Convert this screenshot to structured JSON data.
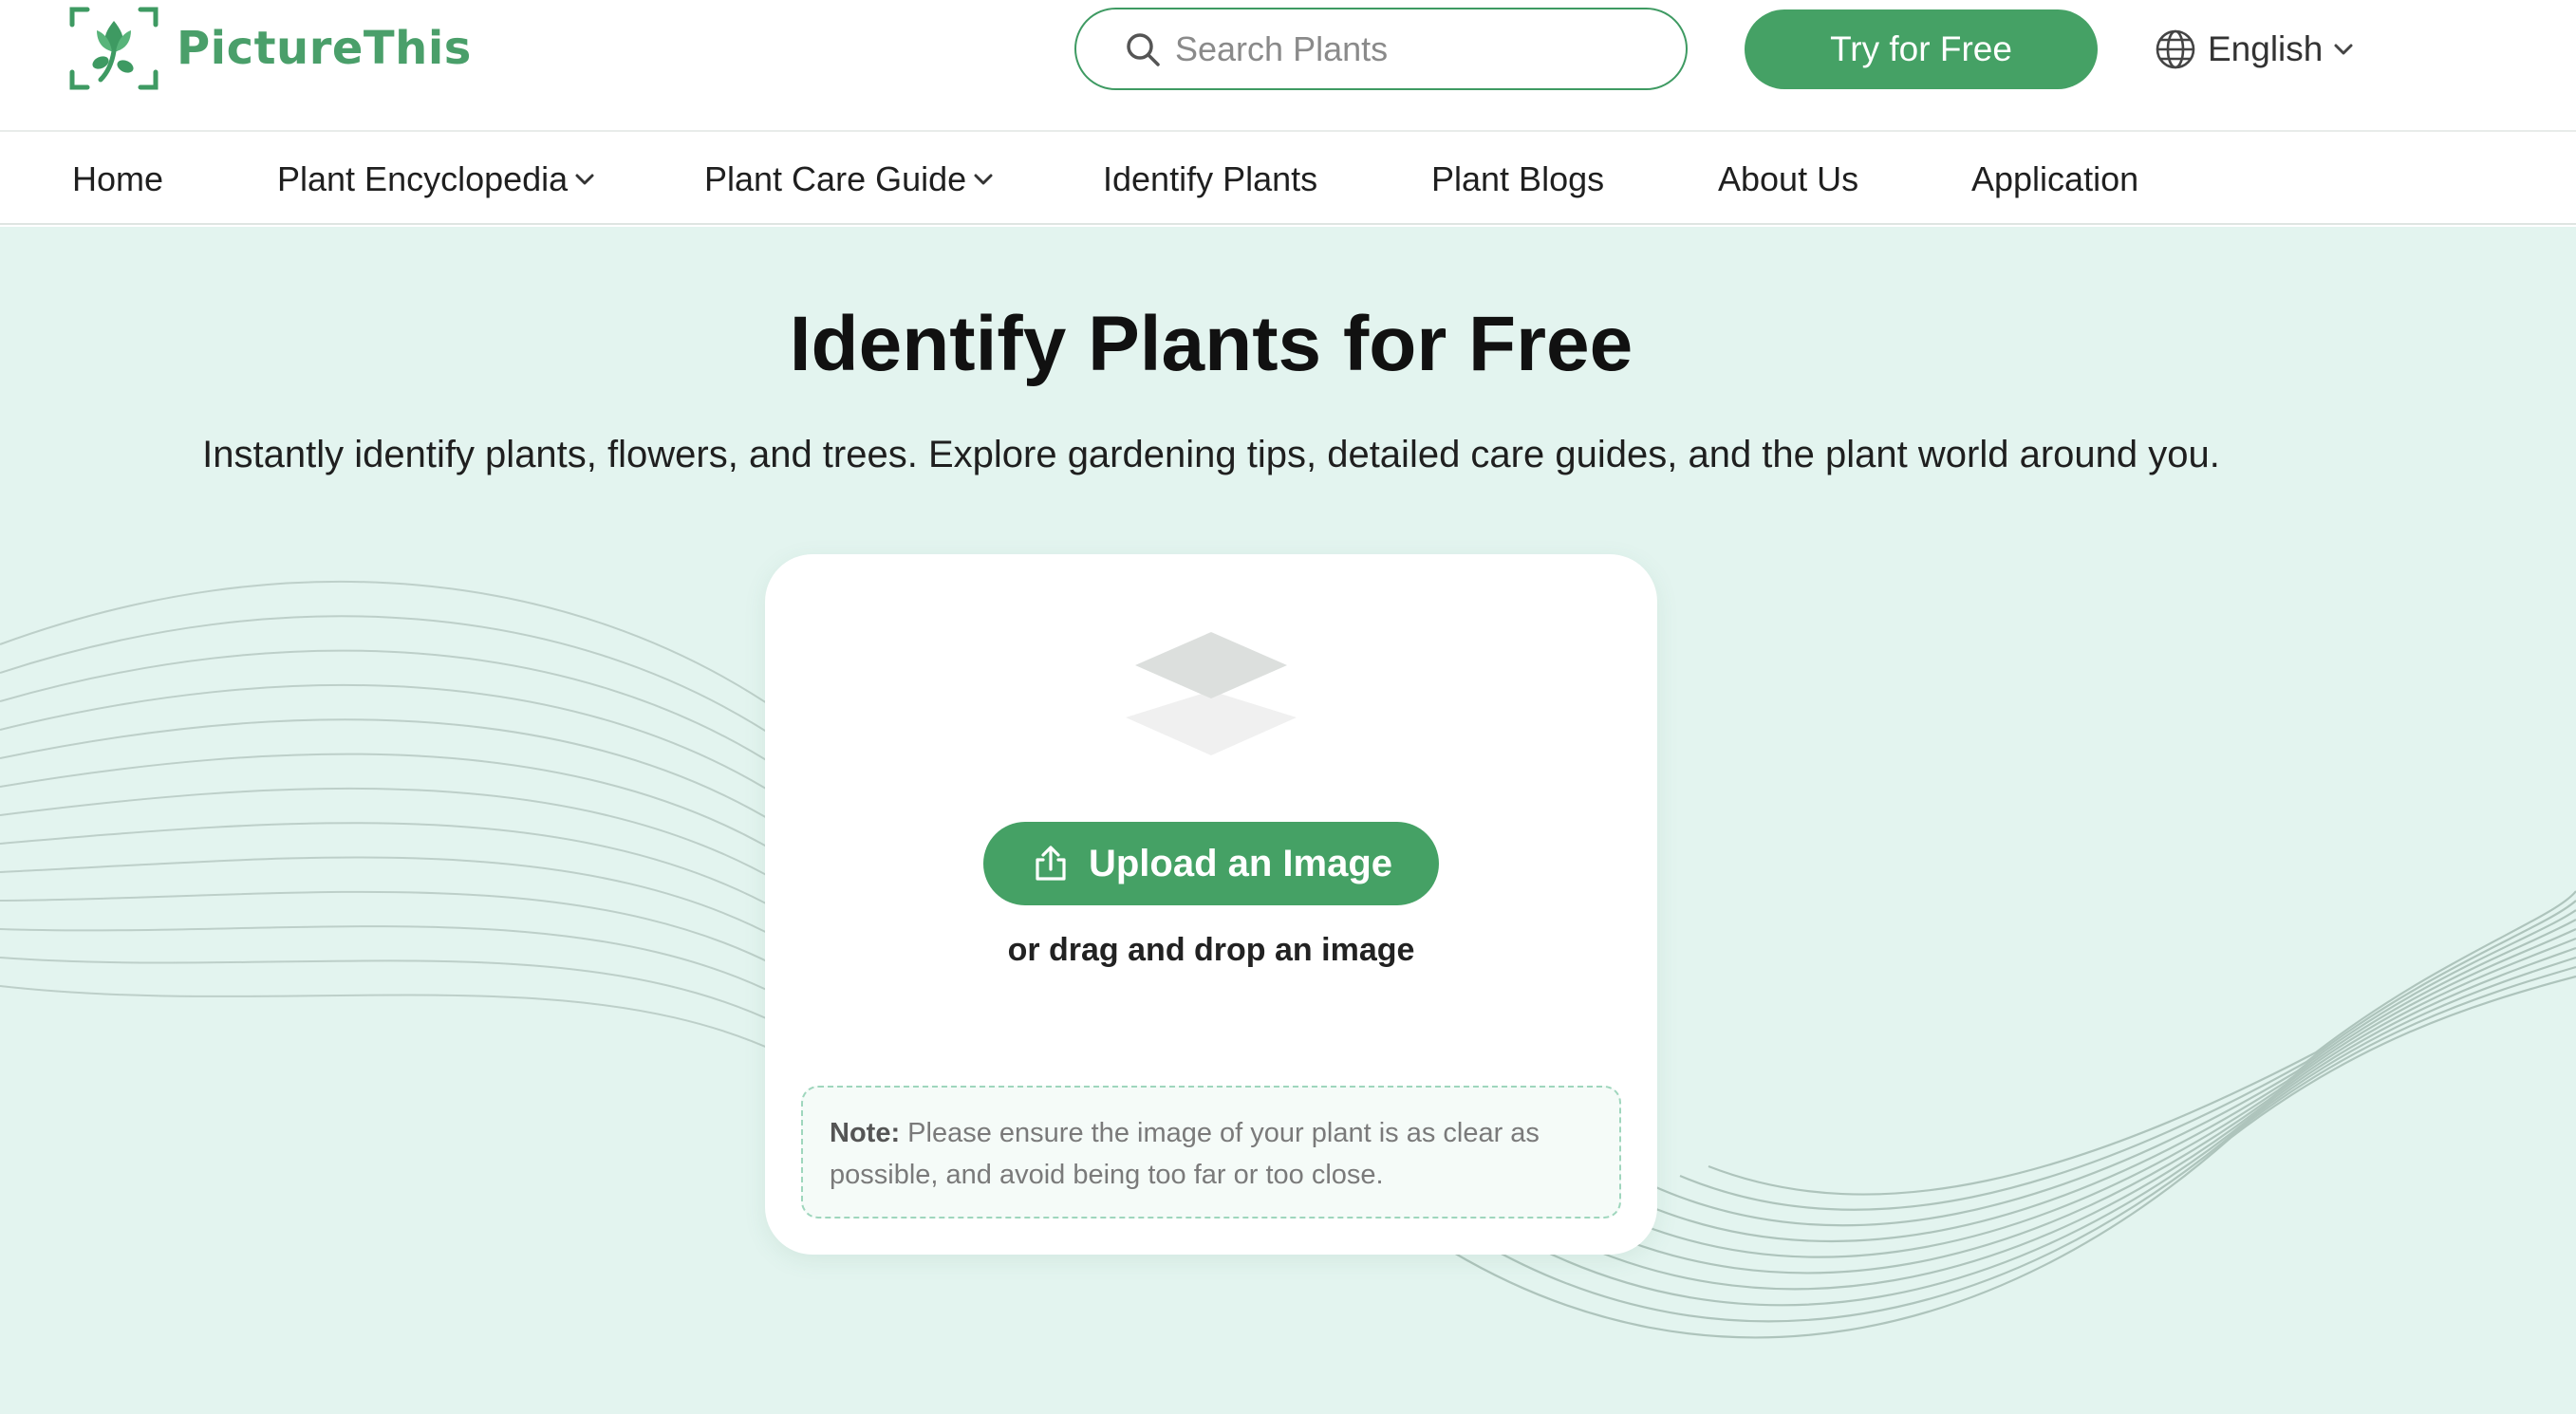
{
  "brand": {
    "name": "PictureThis",
    "accent": "#45a165",
    "logo_icon": "leaf-scan-logo-icon"
  },
  "header": {
    "search_placeholder": "Search Plants",
    "search_icon": "search-icon",
    "try_button": "Try for Free",
    "language": "English",
    "language_icon": "globe-icon"
  },
  "nav": {
    "items": [
      {
        "label": "Home",
        "dropdown": false
      },
      {
        "label": "Plant Encyclopedia",
        "dropdown": true
      },
      {
        "label": "Plant Care Guide",
        "dropdown": true
      },
      {
        "label": "Identify Plants",
        "dropdown": false
      },
      {
        "label": "Plant Blogs",
        "dropdown": false
      },
      {
        "label": "About Us",
        "dropdown": false
      },
      {
        "label": "Application",
        "dropdown": false
      }
    ]
  },
  "hero": {
    "title": "Identify Plants for Free",
    "subtitle": "Instantly identify plants, flowers, and trees. Explore gardening tips, detailed care guides, and the plant world around you.",
    "background": "#e3f4ef"
  },
  "upload": {
    "placeholder_icon": "image-layers-icon",
    "button_label": "Upload an Image",
    "button_icon": "upload-icon",
    "drag_text": "or drag and drop an image",
    "note_label": "Note:",
    "note_text": "Please ensure the image of your plant is as clear as possible, and avoid being too far or too close."
  }
}
